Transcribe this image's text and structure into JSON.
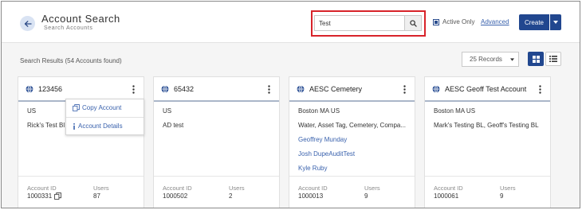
{
  "header": {
    "title": "Account Search",
    "subtitle": "Search Accounts"
  },
  "search": {
    "value": "Test"
  },
  "filters": {
    "active_only_label": "Active Only",
    "advanced_label": "Advanced"
  },
  "create": {
    "label": "Create"
  },
  "results": {
    "summary": "Search Results (54 Accounts found)",
    "records_option": "25 Records"
  },
  "cards": [
    {
      "name": "123456",
      "lines": [
        "US",
        "Rick's Test Bl"
      ],
      "links": [],
      "account_id_label": "Account ID",
      "account_id": "1000331",
      "users_label": "Users",
      "users": "87"
    },
    {
      "name": "65432",
      "lines": [
        "US",
        "AD test"
      ],
      "links": [],
      "account_id_label": "Account ID",
      "account_id": "1000502",
      "users_label": "Users",
      "users": "2"
    },
    {
      "name": "AESC Cemetery",
      "lines": [
        "Boston MA US",
        "Water, Asset Tag, Cemetery, Compa..."
      ],
      "links": [
        "Geoffrey Munday",
        "Josh DupeAuditTest",
        "Kyle Ruby"
      ],
      "account_id_label": "Account ID",
      "account_id": "1000013",
      "users_label": "Users",
      "users": "9"
    },
    {
      "name": "AESC Geoff Test Account",
      "lines": [
        "Boston MA US",
        "Mark's Testing BL, Geoff's Testing BL"
      ],
      "links": [],
      "account_id_label": "Account ID",
      "account_id": "1000061",
      "users_label": "Users",
      "users": "9"
    }
  ],
  "menu": {
    "copy_label": "Copy Account",
    "details_label": "Account Details"
  },
  "colors": {
    "primary": "#21478f",
    "link": "#3a62ad",
    "highlight": "#d8232a"
  }
}
